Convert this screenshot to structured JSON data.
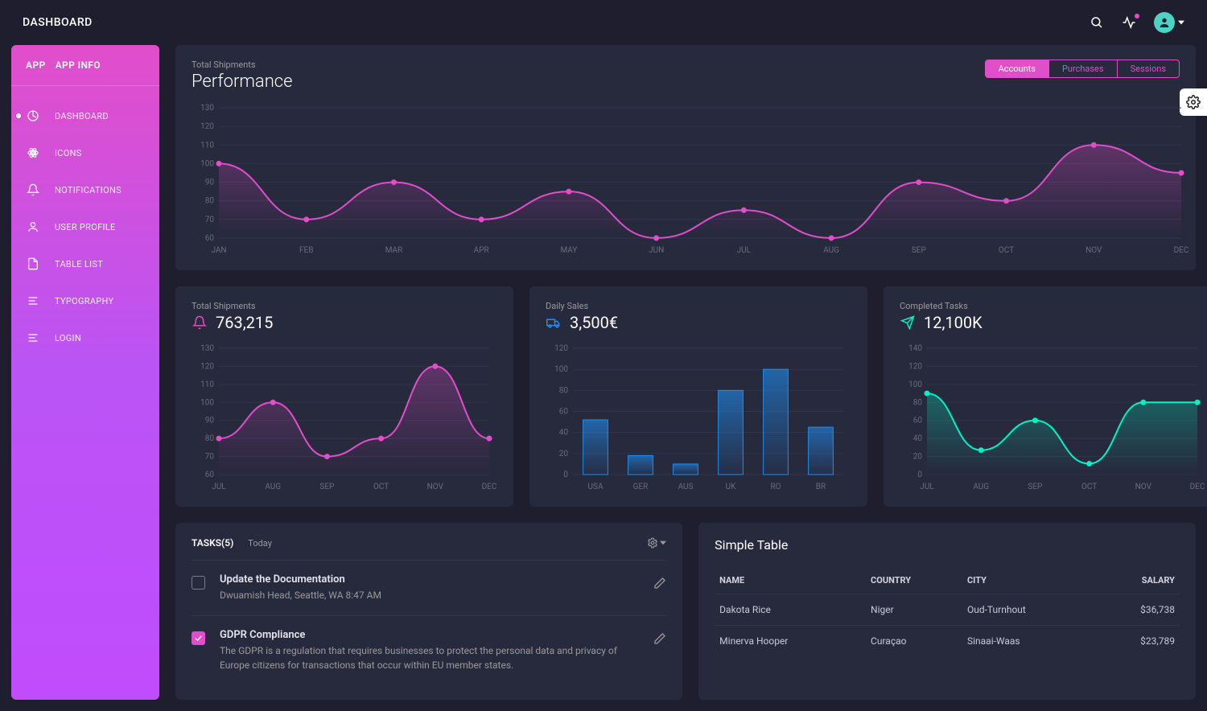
{
  "topbar": {
    "title": "DASHBOARD"
  },
  "sidebar": {
    "brand_short": "APP",
    "brand_long": "APP INFO",
    "items": [
      {
        "label": "DASHBOARD",
        "active": true
      },
      {
        "label": "ICONS"
      },
      {
        "label": "NOTIFICATIONS"
      },
      {
        "label": "USER PROFILE"
      },
      {
        "label": "TABLE LIST"
      },
      {
        "label": "TYPOGRAPHY"
      },
      {
        "label": "LOGIN"
      }
    ]
  },
  "performance": {
    "subtitle": "Total Shipments",
    "title": "Performance",
    "tabs": [
      "Accounts",
      "Purchases",
      "Sessions"
    ],
    "active_tab": 0
  },
  "mini": {
    "shipments": {
      "subtitle": "Total Shipments",
      "value": "763,215"
    },
    "sales": {
      "subtitle": "Daily Sales",
      "value": "3,500€"
    },
    "tasks": {
      "subtitle": "Completed Tasks",
      "value": "12,100K"
    }
  },
  "tasks_card": {
    "heading": "TASKS(5)",
    "when": "Today",
    "items": [
      {
        "title": "Update the Documentation",
        "desc": "Dwuamish Head, Seattle, WA 8:47 AM",
        "checked": false
      },
      {
        "title": "GDPR Compliance",
        "desc": "The GDPR is a regulation that requires businesses to protect the personal data and privacy of Europe citizens for transactions that occur within EU member states.",
        "checked": true
      }
    ]
  },
  "table_card": {
    "title": "Simple Table",
    "headers": [
      "NAME",
      "COUNTRY",
      "CITY",
      "SALARY"
    ],
    "rows": [
      [
        "Dakota Rice",
        "Niger",
        "Oud-Turnhout",
        "$36,738"
      ],
      [
        "Minerva Hooper",
        "Curaçao",
        "Sinaai-Waas",
        "$23,789"
      ]
    ]
  },
  "colors": {
    "pink": "#e14eca",
    "blue": "#1f8ef1",
    "teal": "#00f2c3"
  },
  "chart_data": [
    {
      "id": "performance",
      "type": "line",
      "title": "Performance",
      "categories": [
        "JAN",
        "FEB",
        "MAR",
        "APR",
        "MAY",
        "JUN",
        "JUL",
        "AUG",
        "SEP",
        "OCT",
        "NOV",
        "DEC"
      ],
      "values": [
        100,
        70,
        90,
        70,
        85,
        60,
        75,
        60,
        90,
        80,
        110,
        95
      ],
      "ylim": [
        60,
        130
      ],
      "xlabel": "",
      "ylabel": "",
      "color": "#e14eca"
    },
    {
      "id": "shipments",
      "type": "line",
      "categories": [
        "JUL",
        "AUG",
        "SEP",
        "OCT",
        "NOV",
        "DEC"
      ],
      "values": [
        80,
        100,
        70,
        80,
        120,
        80
      ],
      "ylim": [
        60,
        130
      ],
      "color": "#e14eca"
    },
    {
      "id": "sales",
      "type": "bar",
      "categories": [
        "USA",
        "GER",
        "AUS",
        "UK",
        "RO",
        "BR"
      ],
      "values": [
        52,
        18,
        10,
        80,
        100,
        45
      ],
      "ylim": [
        0,
        120
      ],
      "color": "#1f8ef1"
    },
    {
      "id": "completed",
      "type": "line",
      "categories": [
        "JUL",
        "AUG",
        "SEP",
        "OCT",
        "NOV",
        "DEC"
      ],
      "values": [
        90,
        27,
        60,
        12,
        80,
        80
      ],
      "ylim": [
        0,
        140
      ],
      "color": "#00f2c3"
    }
  ]
}
